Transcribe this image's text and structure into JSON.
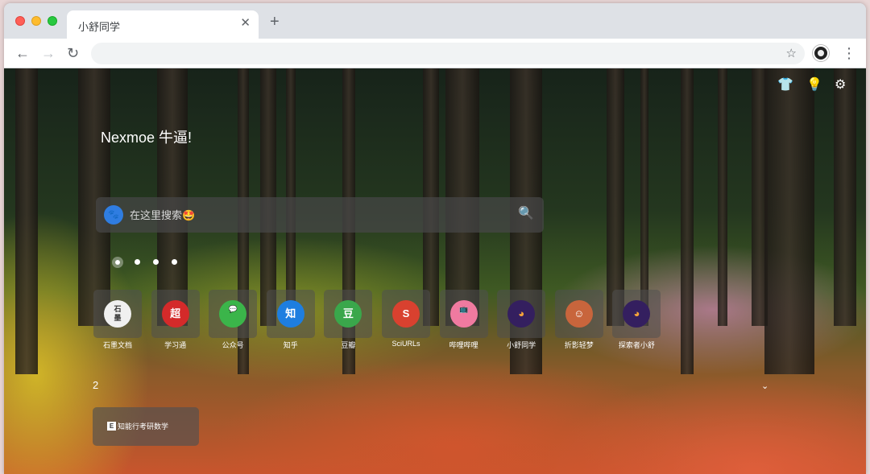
{
  "browser": {
    "tab_title": "小舒同学",
    "tab_close_glyph": "✕",
    "new_tab_glyph": "+",
    "back_glyph": "←",
    "forward_glyph": "→",
    "reload_glyph": "↻",
    "address_value": "",
    "star_glyph": "☆",
    "menu_glyph": "⋮"
  },
  "page": {
    "greeting": "Nexmoe 牛逼!",
    "top_icons": [
      {
        "name": "shirt-icon",
        "glyph": "👕"
      },
      {
        "name": "lightbulb-icon",
        "glyph": "💡"
      },
      {
        "name": "gear-icon",
        "glyph": "⚙"
      }
    ],
    "search": {
      "placeholder": "在这里搜索🤩",
      "engine_glyph": "🐾",
      "search_glyph": "🔍"
    },
    "pager": {
      "count": 4,
      "active": 0
    },
    "shortcuts": [
      {
        "label": "石墨文档",
        "glyph": "石墨",
        "color": "#f0f0f0",
        "text_color": "#333333"
      },
      {
        "label": "学习通",
        "glyph": "超",
        "color": "#d42a2a",
        "text_color": "#ffffff"
      },
      {
        "label": "公众号",
        "glyph": "💬",
        "color": "#3bb54a",
        "text_color": "#ffffff"
      },
      {
        "label": "知乎",
        "glyph": "知",
        "color": "#1e7ee0",
        "text_color": "#ffffff"
      },
      {
        "label": "豆瓣",
        "glyph": "豆",
        "color": "#3aa74b",
        "text_color": "#ffffff"
      },
      {
        "label": "SciURLs",
        "glyph": "S",
        "color": "#d9412f",
        "text_color": "#ffffff"
      },
      {
        "label": "哔哩哔哩",
        "glyph": "📺",
        "color": "#f07aa0",
        "text_color": "#ffffff"
      },
      {
        "label": "小舒同学",
        "glyph": "◕",
        "color": "#341f5f",
        "text_color": "#f6a33a"
      },
      {
        "label": "折影轻梦",
        "glyph": "☺",
        "color": "#c8653c",
        "text_color": "#ffffff"
      },
      {
        "label": "探索者小舒",
        "glyph": "◕",
        "color": "#341f5f",
        "text_color": "#f6a33a"
      }
    ],
    "group": {
      "label": "2",
      "chevron_glyph": "⌄"
    },
    "bookmark": {
      "label": "知能行考研数学",
      "glyph": "E"
    }
  }
}
